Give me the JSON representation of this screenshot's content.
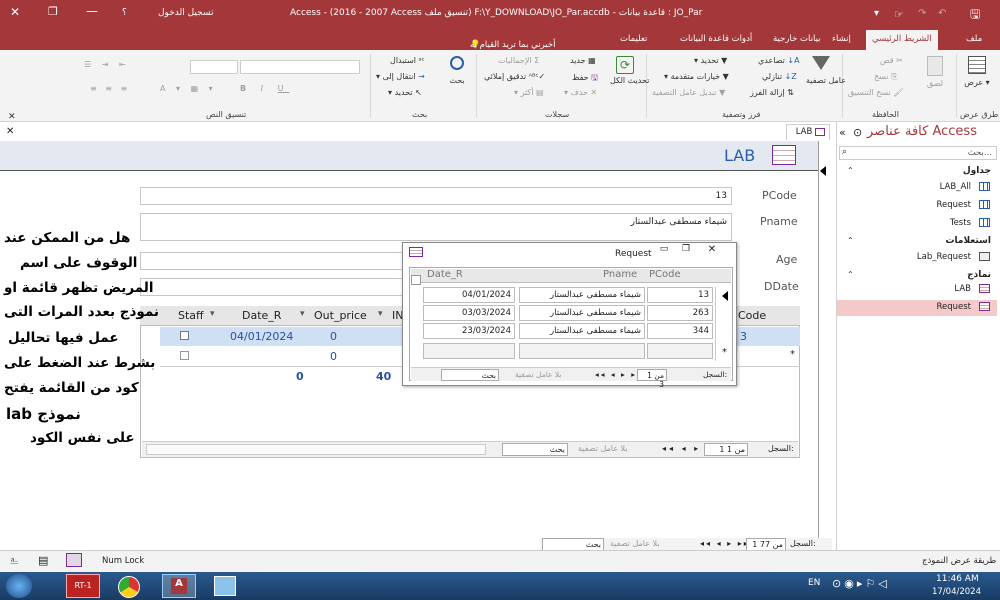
{
  "window": {
    "title": "Access - (2016 - 2007 Access تنسيق ملف) F:\\Y_DOWNLOAD\\JO_Par.accdb - قاعدة بيانات : JO_Par",
    "signin": "تسجيل الدخول",
    "help": "؟"
  },
  "tabs": {
    "file": "ملف",
    "home": "الشريط الرئيسي",
    "create": "إنشاء",
    "external": "بيانات خارجية",
    "dbtools": "أدوات قاعدة البيانات",
    "help": "تعليمات",
    "tellme": "أخبرني بما تريد القيام به"
  },
  "ribbon": {
    "views": {
      "view": "عرض",
      "group": "طرق عرض"
    },
    "clipboard": {
      "cut": "قص",
      "copy": "نسخ",
      "paste": "لصق",
      "format_painter": "نسخ التنسيق",
      "group": "الحافظة"
    },
    "sort": {
      "filter": "عامل تصفية",
      "ascending": "تصاعدي",
      "descending": "تنازلي",
      "remove_sort": "إزالة الفرز",
      "selection": "تحديد",
      "advanced": "خيارات متقدمة",
      "toggle": "تبديل عامل التصفية",
      "group": "فرز وتصفية"
    },
    "records": {
      "refresh": "تحديث الكل",
      "new": "جديد",
      "save": "حفظ",
      "delete": "حذف",
      "totals": "الإجماليات",
      "spelling": "تدقيق إملائي",
      "more": "أكثر",
      "group": "سجلات"
    },
    "find": {
      "find": "بحث",
      "replace": "استبدال",
      "goto": "انتقال إلى",
      "select": "تحديد",
      "group": "بحث"
    },
    "text": {
      "group": "تنسيق النص"
    }
  },
  "doc_tab": {
    "label": "LAB"
  },
  "form": {
    "title": "LAB",
    "fields": [
      {
        "label": "PCode",
        "value": "13"
      },
      {
        "label": "Pname",
        "value": "شيماء مسطفى عبدالستار"
      },
      {
        "label": "Age",
        "value": ""
      },
      {
        "label": "DDate",
        "value": ""
      }
    ],
    "subform": {
      "columns": [
        "Staff",
        "Date_R",
        "Out_price",
        "IN",
        "Code"
      ],
      "row1": {
        "date": "04/01/2024",
        "out": "0",
        "code": "3"
      },
      "row2": {
        "out": "0"
      },
      "totals": {
        "out": "0",
        "in": "40"
      },
      "nav": {
        "record": "السجل:",
        "pos": "1 من 1",
        "nofilter": "بلا عامل تصفية",
        "search": "بحث"
      }
    }
  },
  "popup": {
    "title": "Request",
    "columns": [
      "Date_R",
      "Pname",
      "PCode"
    ],
    "rows": [
      {
        "date": "04/01/2024",
        "name": "شيماء مسطفى عبدالستار",
        "code": "13"
      },
      {
        "date": "03/03/2024",
        "name": "شيماء مسطفى عبدالستار",
        "code": "263"
      },
      {
        "date": "23/03/2024",
        "name": "شيماء مسطفى عبدالستار",
        "code": "344"
      }
    ],
    "nav": {
      "record": "السجل:",
      "pos": "1 من 3",
      "nofilter": "بلا عامل تصفية",
      "search": "بحث"
    }
  },
  "overlay": [
    "هل من الممكن عند",
    "الوقوف على اسم",
    "المريض تظهر قائمة او",
    "نموذج بعدد المرات التى",
    "عمل فيها تحاليل",
    "بشرط عند الضغط على",
    "كود من القائمة يفتح",
    "نموذج lab",
    "على نفس الكود"
  ],
  "nav_pane": {
    "title": "كافة عناصر Access",
    "search": "بحث...",
    "tables_hdr": "جداول",
    "tables": [
      "LAB_All",
      "Request",
      "Tests"
    ],
    "queries_hdr": "استعلامات",
    "queries": [
      "Lab_Request"
    ],
    "forms_hdr": "نماذج",
    "forms": [
      "LAB",
      "Request"
    ]
  },
  "main_nav": {
    "record": "السجل:",
    "pos": "1 من 77",
    "nofilter": "بلا عامل تصفية",
    "search": "بحث"
  },
  "status": {
    "left": "طريقة عرض النموذج",
    "numlock": "Num Lock"
  },
  "taskbar": {
    "lang": "EN",
    "time": "11:46 AM",
    "date": "17/04/2024"
  }
}
